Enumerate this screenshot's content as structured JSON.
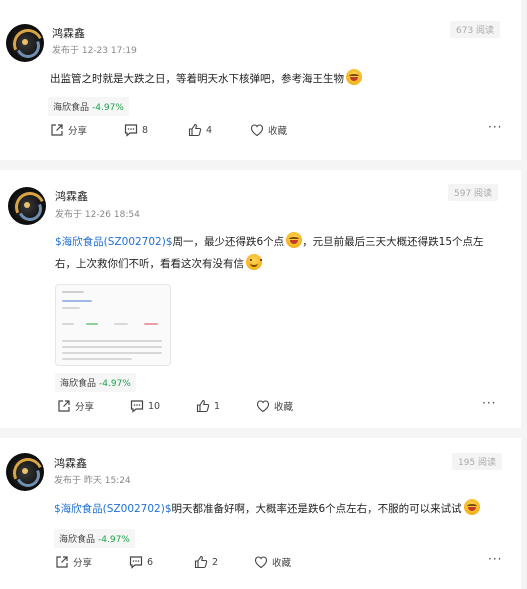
{
  "posts": [
    {
      "username": "鸿霖鑫",
      "time": "发布于 12-23 17:19",
      "views": "673 阅读",
      "segments": [
        {
          "type": "text",
          "text": "出监管之时就是大跌之日，等着明天水下核弹吧，参考海王生物"
        }
      ],
      "stock_name": "海欣食品",
      "stock_change": "-4.97%",
      "share_label": "分享",
      "comment_count": "8",
      "like_count": "4",
      "fav_label": "收藏"
    },
    {
      "username": "鸿霖鑫",
      "time": "发布于 12-26 18:54",
      "views": "597 阅读",
      "line1_link": "$海欣食品(SZ002702)$",
      "line1_text": "周一，最少还得跌6个点",
      "line1_text2": "，元旦前最后三天大概还得跌15个点左",
      "line2_text": "右，上次救你们不听，看看这次有没有信",
      "stock_name": "海欣食品",
      "stock_change": "-4.97%",
      "share_label": "分享",
      "comment_count": "10",
      "like_count": "1",
      "fav_label": "收藏"
    },
    {
      "username": "鸿霖鑫",
      "time": "发布于 昨天 15:24",
      "views": "195 阅读",
      "line1_link": "$海欣食品(SZ002702)$",
      "line1_text": "明天都准备好啊，大概率还是跌6个点左右，不服的可以来试试",
      "stock_name": "海欣食品",
      "stock_change": "-4.97%",
      "share_label": "分享",
      "comment_count": "6",
      "like_count": "2",
      "fav_label": "收藏"
    }
  ],
  "icons": [
    "share-icon",
    "comment-icon",
    "like-icon",
    "favorite-icon",
    "more-icon",
    "emoji-laugh-icon",
    "emoji-smile-icon"
  ],
  "colors": {
    "link": "#1f6fd6",
    "change_down": "#1aa34a"
  }
}
